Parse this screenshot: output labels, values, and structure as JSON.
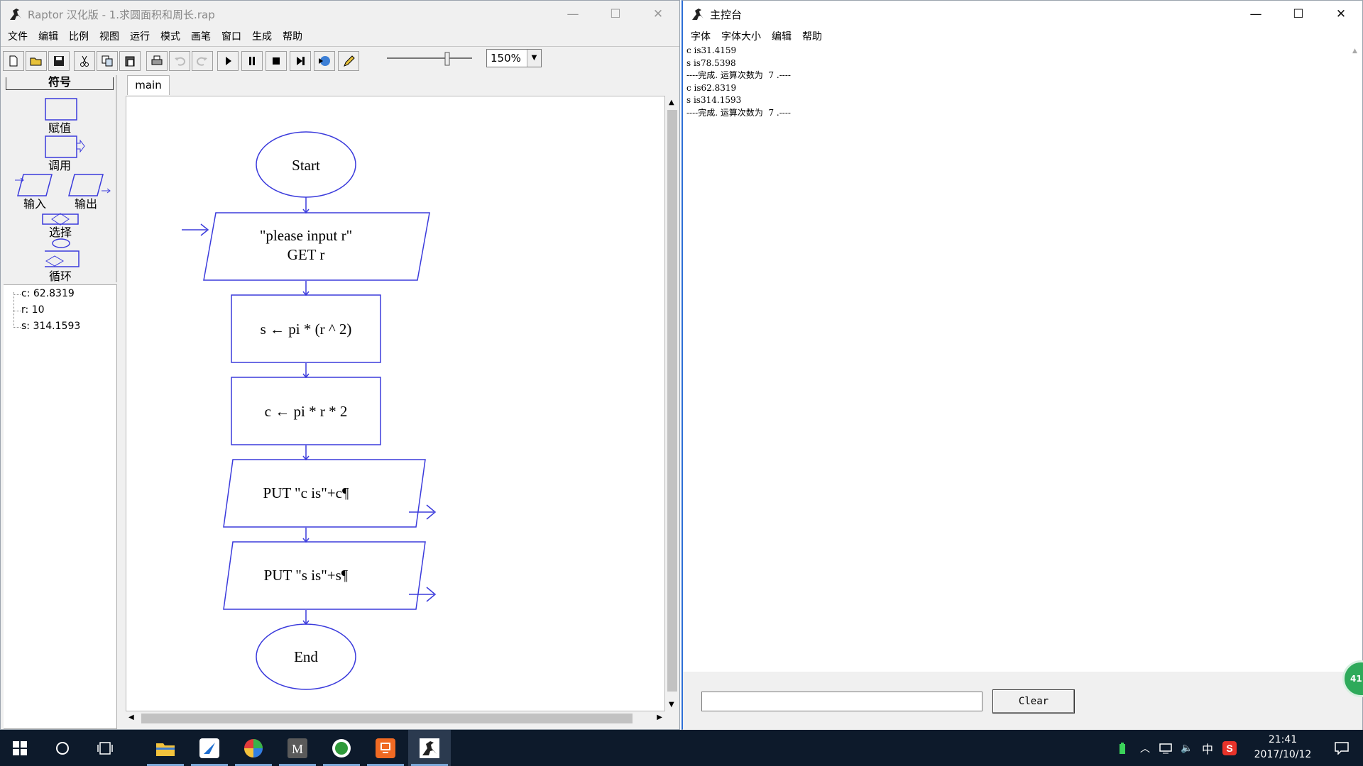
{
  "raptor": {
    "title": "Raptor 汉化版 - 1.求圆面积和周长.rap",
    "caption_buttons": [
      "—",
      "☐",
      "✕"
    ],
    "menu": [
      "文件",
      "编辑",
      "比例",
      "视图",
      "运行",
      "模式",
      "画笔",
      "窗口",
      "生成",
      "帮助"
    ],
    "toolbar_icons": [
      "new-file-icon",
      "open-folder-icon",
      "save-icon",
      "cut-icon",
      "copy-icon",
      "paste-icon",
      "print-icon",
      "undo-icon",
      "redo-icon",
      "play-icon",
      "pause-icon",
      "stop-icon",
      "step-icon",
      "test-server-icon",
      "pen-icon"
    ],
    "zoom": "150%",
    "symbols_header": "符号",
    "symbols": [
      {
        "label": "赋值",
        "icon": "assignment-symbol-icon"
      },
      {
        "label": "调用",
        "icon": "call-symbol-icon"
      },
      {
        "label": "输入",
        "icon": "input-symbol-icon"
      },
      {
        "label": "输出",
        "icon": "output-symbol-icon"
      },
      {
        "label": "选择",
        "icon": "selection-symbol-icon"
      },
      {
        "label": "循环",
        "icon": "loop-symbol-icon"
      }
    ],
    "variables": [
      "c: 62.8319",
      "r: 10",
      "s: 314.1593"
    ],
    "tab": "main",
    "flowchart": {
      "start": "Start",
      "input_prompt": "\"please input r\"",
      "input_get": "GET r",
      "assign_s": "s ← pi * (r ^ 2)",
      "assign_c": "c ← pi * r * 2",
      "output_c": "PUT \"c is\"+c¶",
      "output_s": "PUT \"s is\"+s¶",
      "end": "End",
      "line_color": "#3b3bdc"
    }
  },
  "console": {
    "title": "主控台",
    "caption_buttons": [
      "—",
      "☐",
      "✕"
    ],
    "menu": [
      "字体",
      "字体大小",
      "编辑",
      "帮助"
    ],
    "output_lines": [
      "c is31.4159",
      "s is78.5398",
      "----完成. 运算次数为  7 .----",
      "c is62.8319",
      "s is314.1593",
      "----完成. 运算次数为  7 .----"
    ],
    "command_value": "",
    "clear_label": "Clear",
    "badge": "41"
  },
  "taskbar": {
    "clock_time": "21:41",
    "clock_date": "2017/10/12",
    "ime": "中",
    "apps": [
      "file-explorer-icon",
      "feather-app-icon",
      "color-wheel-app-icon",
      "m-app-icon",
      "green-app-icon",
      "presentation-app-icon",
      "raptor-app-icon"
    ],
    "background": "#0d1a2b"
  }
}
